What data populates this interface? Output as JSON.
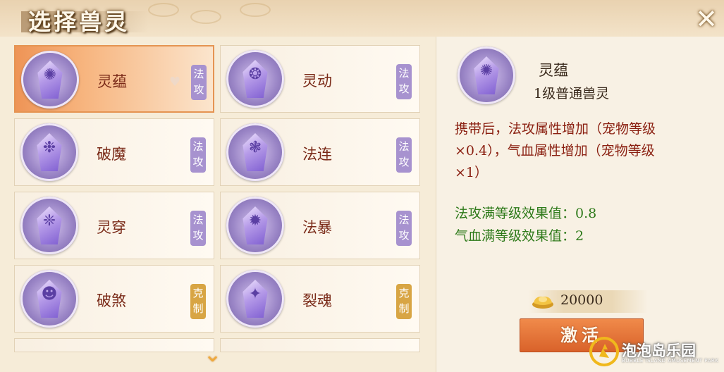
{
  "header": {
    "title": "选择兽灵"
  },
  "cards": [
    {
      "name": "灵蕴",
      "tag": "法攻",
      "tag_color": "#a792cf",
      "icon": "spirit-crystal-icon",
      "selected": true,
      "favorite_icon": "heart-icon"
    },
    {
      "name": "灵动",
      "tag": "法攻",
      "tag_color": "#a792cf",
      "icon": "spirit-crystal-icon"
    },
    {
      "name": "破魔",
      "tag": "法攻",
      "tag_color": "#a792cf",
      "icon": "spirit-crystal-icon"
    },
    {
      "name": "法连",
      "tag": "法攻",
      "tag_color": "#a792cf",
      "icon": "spirit-crystal-icon"
    },
    {
      "name": "灵穿",
      "tag": "法攻",
      "tag_color": "#a792cf",
      "icon": "spirit-crystal-icon"
    },
    {
      "name": "法暴",
      "tag": "法攻",
      "tag_color": "#a792cf",
      "icon": "spirit-crystal-icon"
    },
    {
      "name": "破煞",
      "tag": "克制",
      "tag_color": "#d8a544",
      "icon": "spirit-crystal-icon"
    },
    {
      "name": "裂魂",
      "tag": "克制",
      "tag_color": "#d8a544",
      "icon": "spirit-crystal-icon"
    }
  ],
  "detail": {
    "name": "灵蕴",
    "level": "1级普通兽灵",
    "desc_part1": "携带后，法攻属性增加（宠物等级",
    "desc_part2": "×0.4），气血属性增加（宠物等级",
    "desc_part3": "×1）",
    "effect1_label": "法攻满等级效果值：",
    "effect1_value": "0.8",
    "effect2_label": "气血满等级效果值：",
    "effect2_value": "2",
    "cost": "20000",
    "activate_label": "激活"
  },
  "watermark": {
    "name": "泡泡岛乐园",
    "sub": "BUBBLE ISLAND AMUSEMENT PARK"
  },
  "colors": {
    "accent": "#e59452",
    "red_text": "#8a1f10",
    "green_text": "#2e7a1a",
    "button": "#d9622a"
  }
}
